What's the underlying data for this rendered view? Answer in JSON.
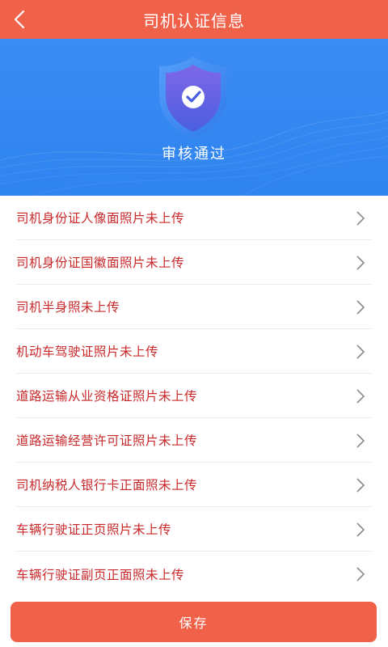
{
  "header": {
    "title": "司机认证信息",
    "back_icon": "chevron-left-icon"
  },
  "banner": {
    "status": "审核通过",
    "icon": "shield-check-icon"
  },
  "items": [
    {
      "label": "司机身份证人像面照片未上传"
    },
    {
      "label": "司机身份证国徽面照片未上传"
    },
    {
      "label": "司机半身照未上传"
    },
    {
      "label": "机动车驾驶证照片未上传"
    },
    {
      "label": "道路运输从业资格证照片未上传"
    },
    {
      "label": "道路运输经营许可证照片未上传"
    },
    {
      "label": "司机纳税人银行卡正面照未上传"
    },
    {
      "label": "车辆行驶证正页照片未上传"
    },
    {
      "label": "车辆行驶证副页正面照未上传"
    }
  ],
  "footer": {
    "save_label": "保存"
  },
  "colors": {
    "header_bg": "#f0614a",
    "banner_bg": "#3b8cf3",
    "item_text": "#c8282a",
    "button_bg": "#f0614a"
  }
}
